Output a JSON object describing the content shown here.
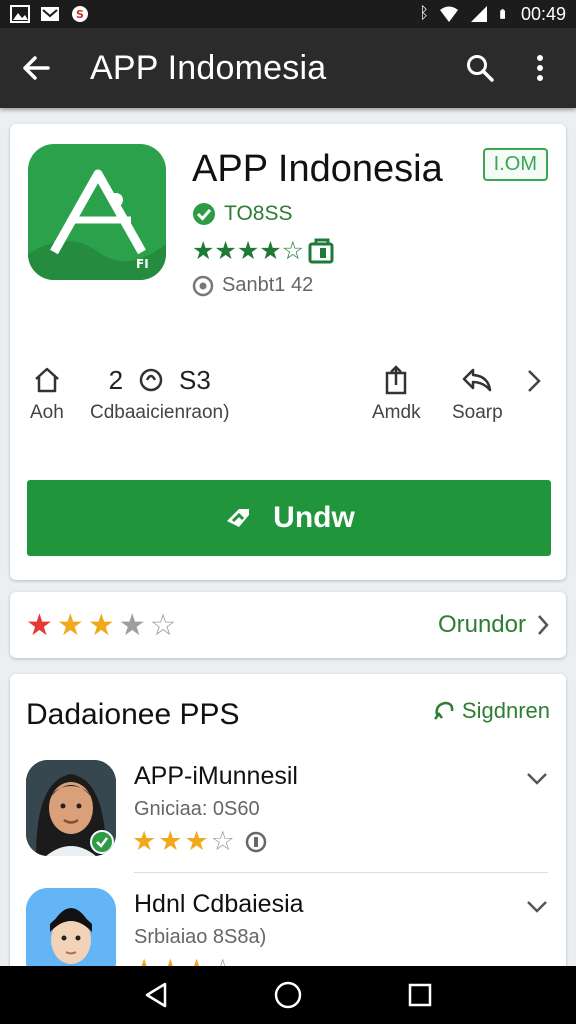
{
  "status_bar": {
    "time": "00:49"
  },
  "app_bar": {
    "title": "APP Indomesia"
  },
  "app": {
    "name": "APP Indonesia",
    "age_badge": "I.OM",
    "developer": "TO8SS",
    "rating_stars": "★★★★☆",
    "size": "Sanbt1 42",
    "stats": [
      {
        "icon": "home-icon",
        "label": "Aoh"
      },
      {
        "number": "2",
        "icon": "sync-icon",
        "number2": "S3",
        "label": "Cdbaaicienraon)"
      },
      {
        "icon": "share-icon",
        "label": "Amdk"
      },
      {
        "icon": "reply-icon",
        "label": "Soarp"
      }
    ],
    "install_label": "Undw"
  },
  "rating_card": {
    "link_label": "Orundor"
  },
  "similar": {
    "heading": "Dadaionee PPS",
    "more_label": "Sigdnren",
    "items": [
      {
        "name": "APP-iMunnesil",
        "sub": "Gniciaa: 0S60"
      },
      {
        "name": "Hdnl Cdbaiesia",
        "sub": "Srbiaiao 8S8a)"
      }
    ]
  },
  "colors": {
    "accent": "#20953c",
    "appbar": "#2b2b2b",
    "star": "#f0a91a"
  }
}
